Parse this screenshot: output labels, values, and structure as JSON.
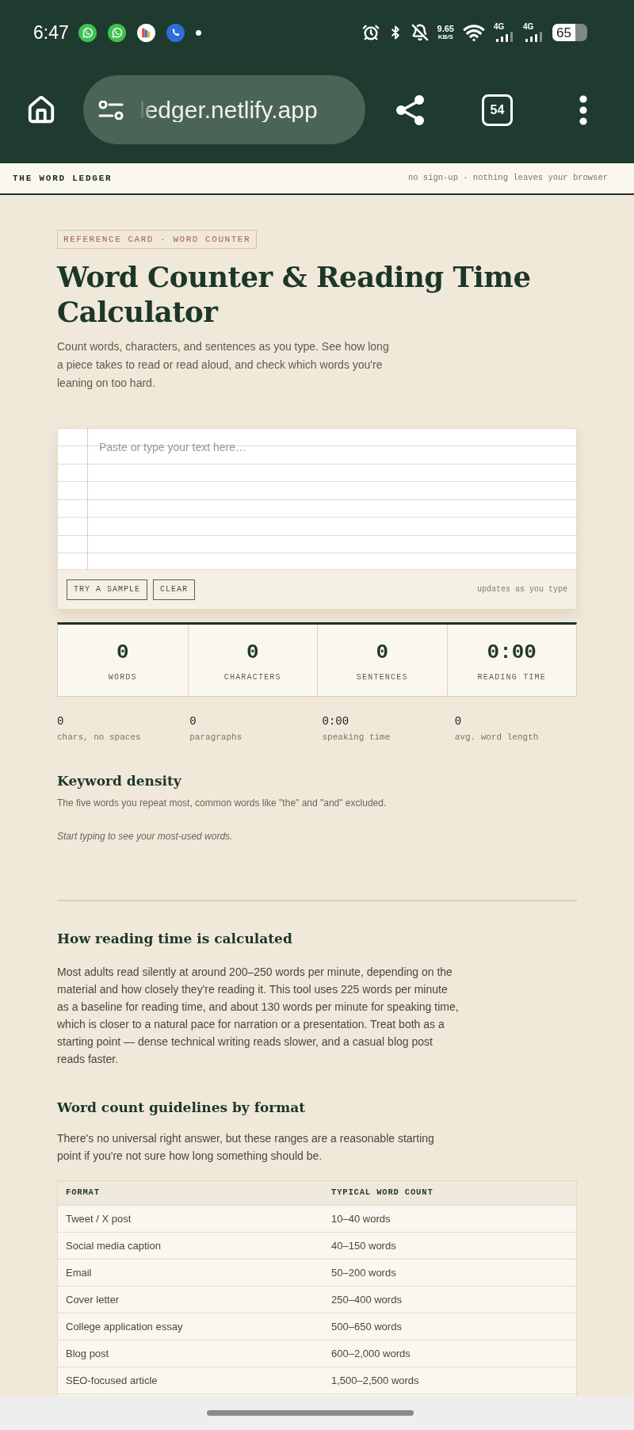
{
  "status_bar": {
    "time": "6:47",
    "network_speed": {
      "value": "9.65",
      "unit": "KB/S"
    },
    "signals": [
      {
        "network": "4G"
      },
      {
        "network": "4G"
      }
    ],
    "battery": {
      "percent": "65",
      "level": 0.65
    }
  },
  "browser": {
    "url": "ledger.netlify.app",
    "tab_count": "54"
  },
  "site_header": {
    "brand": "THE WORD LEDGER",
    "tagline": "no sign-up · nothing leaves your browser"
  },
  "hero": {
    "badge": "REFERENCE CARD · WORD COUNTER",
    "title": "Word Counter & Reading Time Calculator",
    "intro": "Count words, characters, and sentences as you type. See how long a piece takes to read or read aloud, and check which words you're leaning on too hard."
  },
  "editor": {
    "placeholder": "Paste or type your text here…",
    "buttons": [
      "TRY A SAMPLE",
      "CLEAR"
    ],
    "hint": "updates as you type"
  },
  "stats": [
    {
      "value": "0",
      "label": "WORDS"
    },
    {
      "value": "0",
      "label": "CHARACTERS"
    },
    {
      "value": "0",
      "label": "SENTENCES"
    },
    {
      "value": "0:00",
      "label": "READING TIME"
    }
  ],
  "secondary_stats": [
    {
      "value": "0",
      "label": "chars, no spaces"
    },
    {
      "value": "0",
      "label": "paragraphs"
    },
    {
      "value": "0:00",
      "label": "speaking time"
    },
    {
      "value": "0",
      "label": "avg. word length"
    }
  ],
  "keyword_density": {
    "heading": "Keyword density",
    "description": "The five words you repeat most, common words like \"the\" and \"and\" excluded.",
    "empty_message": "Start typing to see your most-used words."
  },
  "reading_time": {
    "heading": "How reading time is calculated",
    "body": "Most adults read silently at around 200–250 words per minute, depending on the material and how closely they're reading it. This tool uses 225 words per minute as a baseline for reading time, and about 130 words per minute for speaking time, which is closer to a natural pace for narration or a presentation. Treat both as a starting point — dense technical writing reads slower, and a casual blog post reads faster."
  },
  "guidelines": {
    "heading": "Word count guidelines by format",
    "intro": "There's no universal right answer, but these ranges are a reasonable starting point if you're not sure how long something should be.",
    "table": {
      "columns": [
        "FORMAT",
        "TYPICAL WORD COUNT"
      ],
      "rows": [
        [
          "Tweet / X post",
          "10–40 words"
        ],
        [
          "Social media caption",
          "40–150 words"
        ],
        [
          "Email",
          "50–200 words"
        ],
        [
          "Cover letter",
          "250–400 words"
        ],
        [
          "College application essay",
          "500–650 words"
        ],
        [
          "Blog post",
          "600–2,000 words"
        ],
        [
          "SEO-focused article",
          "1,500–2,500 words"
        ]
      ]
    }
  }
}
